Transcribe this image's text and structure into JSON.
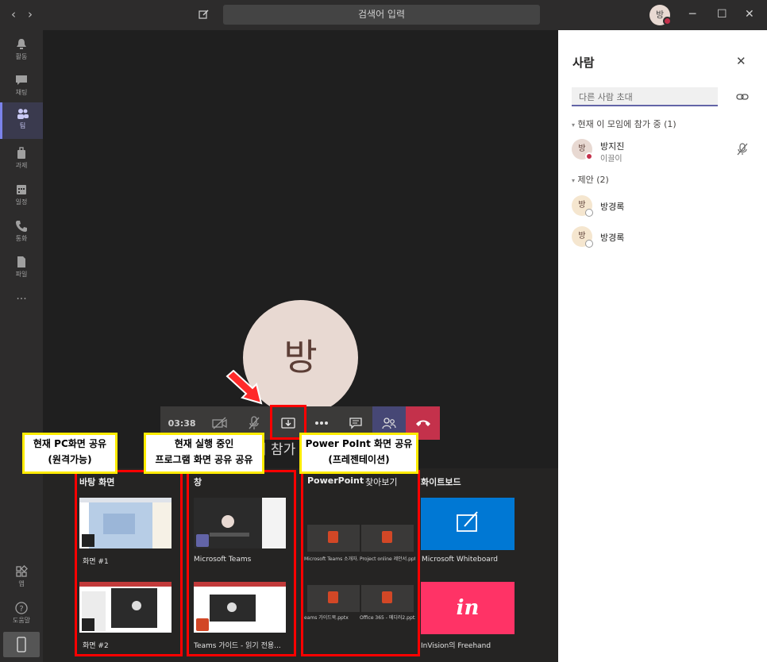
{
  "titlebar": {
    "search_placeholder": "검색어 입력",
    "user_initial": "방"
  },
  "rail": {
    "items": [
      {
        "label": "활동",
        "icon": "bell-icon"
      },
      {
        "label": "채팅",
        "icon": "chat-icon"
      },
      {
        "label": "팀",
        "icon": "teams-icon"
      },
      {
        "label": "과제",
        "icon": "assignments-icon"
      },
      {
        "label": "일정",
        "icon": "calendar-icon"
      },
      {
        "label": "통화",
        "icon": "phone-icon"
      },
      {
        "label": "파일",
        "icon": "files-icon"
      }
    ],
    "more": "···",
    "apps_label": "앱",
    "help_label": "도움말"
  },
  "meeting": {
    "avatar_initial": "방",
    "timer": "03:38",
    "join_text": "이 참가"
  },
  "share": {
    "desktop": {
      "title": "바탕 화면",
      "items": [
        "화면 #1",
        "화면 #2"
      ]
    },
    "window": {
      "title": "창",
      "items": [
        "Microsoft Teams",
        "Teams 가이드 - 읽기 전용..."
      ]
    },
    "powerpoint": {
      "title": "PowerPoint",
      "browse": "찾아보기",
      "files": [
        "Microsoft Teams 소개자...",
        "Project online 제안서.pptx",
        "eams 가이드북.pptx",
        "Office 365 - 메디러2.pptx"
      ]
    },
    "whiteboard": {
      "title": "화이트보드",
      "items": [
        "Microsoft Whiteboard",
        "InVision의 Freehand"
      ],
      "invision_mark": "in"
    }
  },
  "annotations": {
    "a1": [
      "현재 PC화면 공유",
      "(원격가능)"
    ],
    "a2": [
      "현재 실행 중인",
      "프로그램 화면 공유 공유"
    ],
    "a3": [
      "Power PoInt 화면 공유",
      "(프레젠테이션)"
    ]
  },
  "people": {
    "title": "사람",
    "invite_placeholder": "다른 사람 초대",
    "in_meeting": "현재 이 모임에 참가 중 (1)",
    "participant": {
      "initial": "방",
      "name": "방지진",
      "role": "이끌이"
    },
    "suggested": "제안 (2)",
    "suggestions": [
      {
        "initial": "방",
        "name": "방경록"
      },
      {
        "initial": "방",
        "name": "방경록"
      }
    ]
  },
  "colors": {
    "accent": "#6264a7",
    "hangup": "#c4314b",
    "annotation_border": "#ff0000",
    "annotation_label": "#ffeb00",
    "whiteboard_tile": "#0078d4",
    "invision_tile": "#ff3366"
  }
}
